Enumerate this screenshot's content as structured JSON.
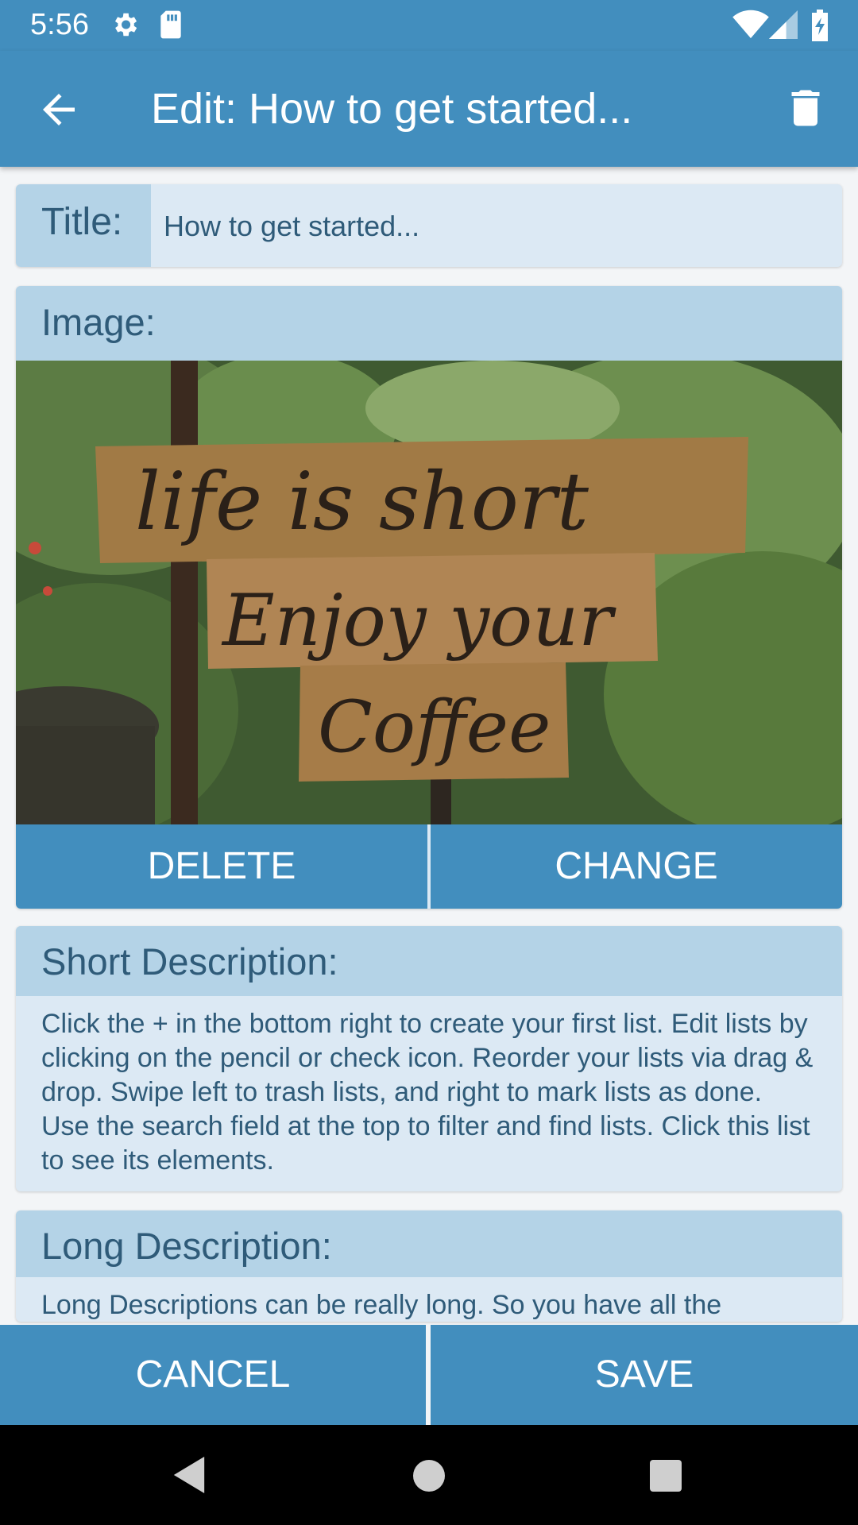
{
  "status": {
    "time": "5:56",
    "icons": [
      "settings-icon",
      "sd-card-icon",
      "wifi-icon",
      "signal-icon",
      "battery-charging-icon"
    ]
  },
  "appbar": {
    "title": "Edit: How to get started...",
    "back_icon": "arrow-back-icon",
    "delete_icon": "trash-icon"
  },
  "title_field": {
    "label": "Title:",
    "value": "How to get started..."
  },
  "image_section": {
    "label": "Image:",
    "photo_text": [
      "life is short",
      "Enjoy your",
      "Coffee"
    ],
    "delete_label": "DELETE",
    "change_label": "CHANGE"
  },
  "short_description": {
    "label": "Short Description:",
    "text": "Click the + in the bottom right to create your first list. Edit lists by clicking on the pencil or check icon. Reorder your lists via drag & drop. Swipe left to trash lists, and right to mark lists as done. Use the search field at the top to filter and find lists. Click this list to see its elements."
  },
  "long_description": {
    "label": "Long Description:",
    "text": "Long Descriptions can be really long. So you have all the"
  },
  "footer": {
    "cancel_label": "CANCEL",
    "save_label": "SAVE"
  },
  "colors": {
    "primary": "#428ebe",
    "header": "#b4d3e7",
    "card": "#dce9f4",
    "text": "#2f5b79"
  }
}
